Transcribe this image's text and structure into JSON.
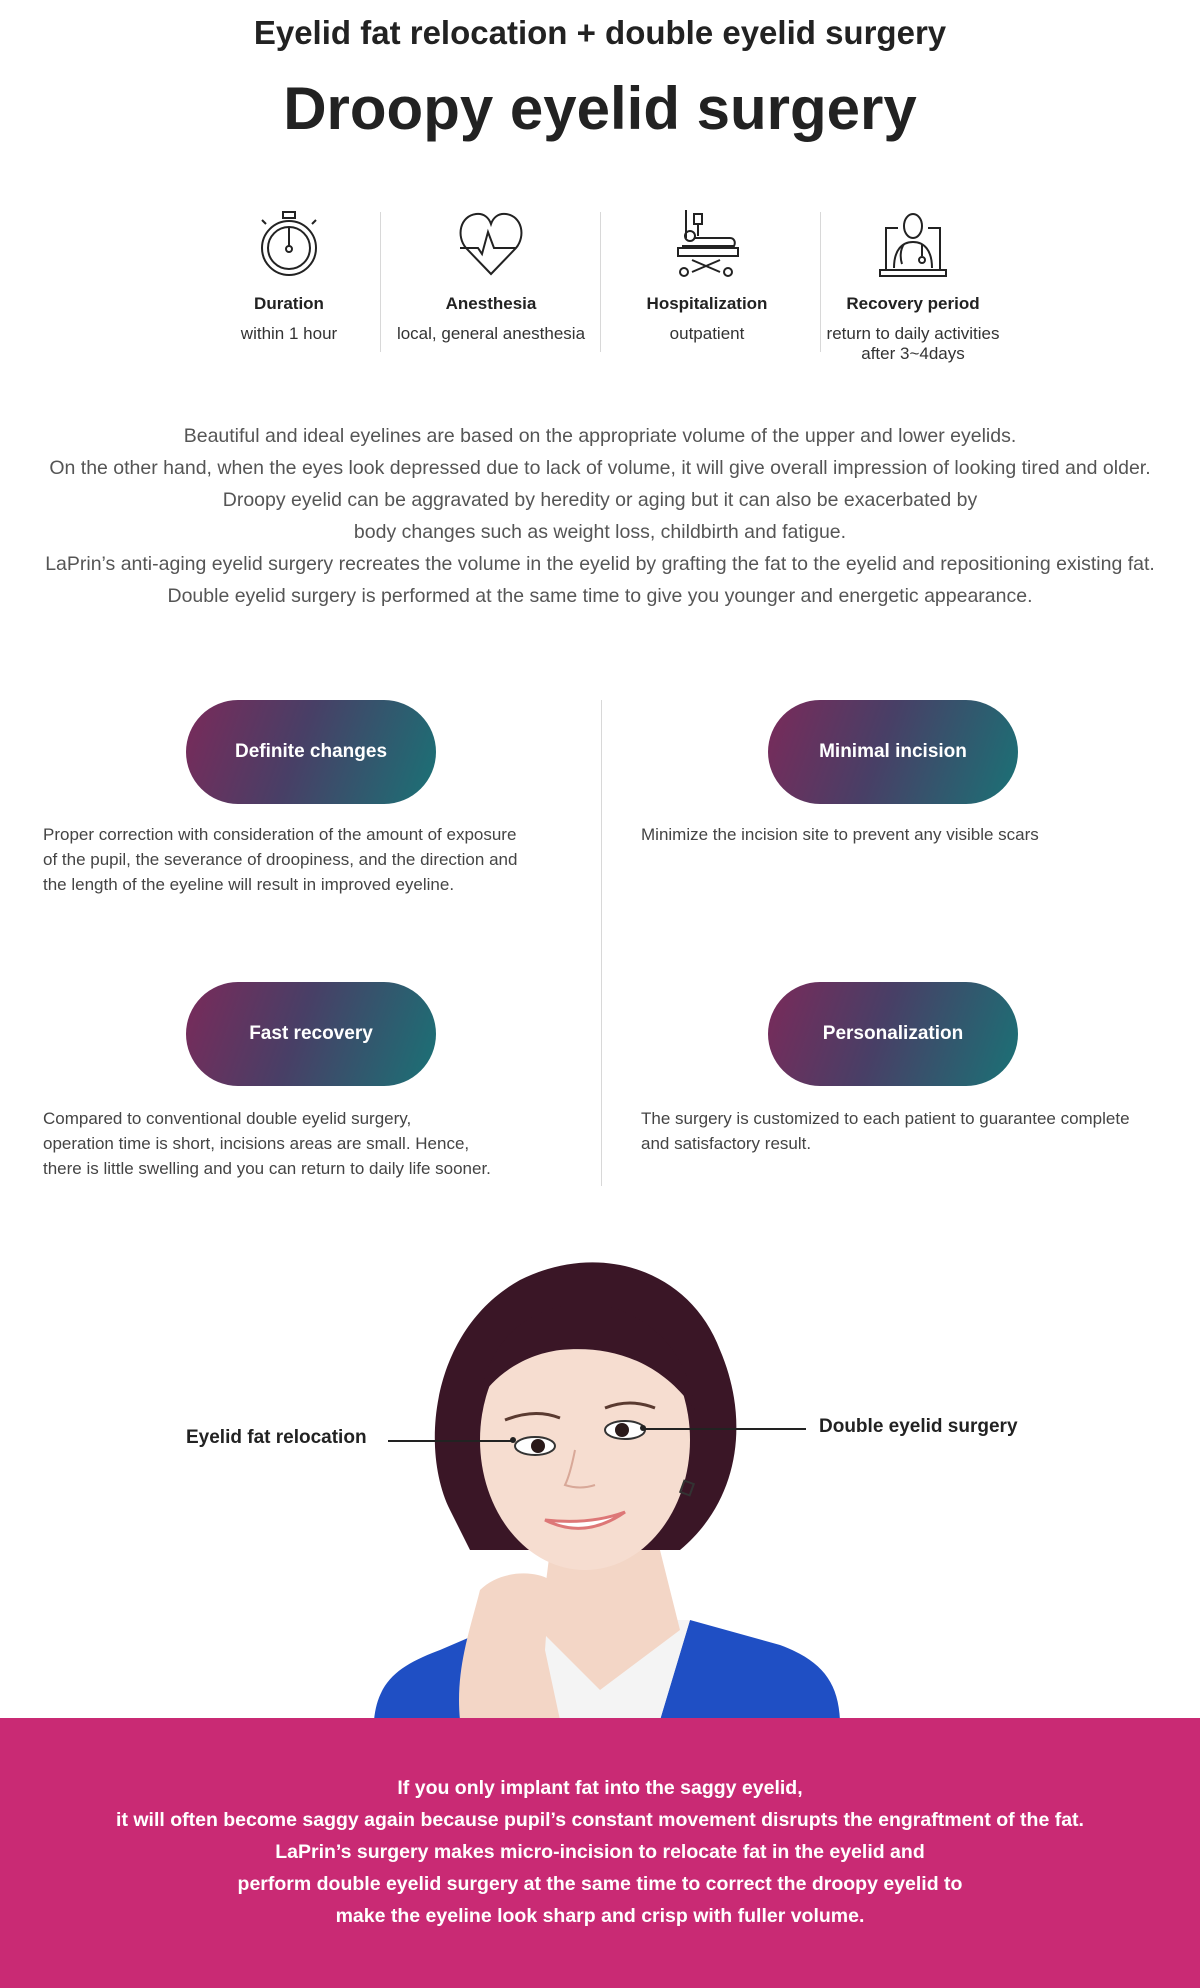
{
  "header": {
    "subtitle": "Eyelid fat relocation + double eyelid surgery",
    "title": "Droopy eyelid surgery"
  },
  "stats": [
    {
      "icon": "stopwatch-icon",
      "label": "Duration",
      "value": "within 1 hour"
    },
    {
      "icon": "heartbeat-icon",
      "label": "Anesthesia",
      "value": "local, general anesthesia"
    },
    {
      "icon": "hospital-bed-icon",
      "label": "Hospitalization",
      "value": "outpatient"
    },
    {
      "icon": "doctor-icon",
      "label": "Recovery period",
      "value": "return to daily activities",
      "value2": "after 3~4days"
    }
  ],
  "intro": [
    "Beautiful and ideal eyelines are based on the appropriate volume of the upper and lower eyelids.",
    "On the other hand, when the eyes look depressed due to lack of volume, it will give overall impression of looking tired and older.",
    "Droopy eyelid can be aggravated by heredity or aging but it can also be exacerbated by",
    "body changes such as weight loss, childbirth and fatigue.",
    "LaPrin’s anti-aging eyelid surgery recreates the volume in the eyelid by grafting the fat to the eyelid and repositioning existing fat.",
    "Double eyelid surgery is performed at the same time to give you younger and energetic appearance."
  ],
  "features": [
    {
      "title": "Definite changes",
      "lines": [
        "Proper correction with consideration of the amount of exposure",
        "of the pupil, the severance of droopiness, and the direction and",
        "the length of the eyeline will result in improved eyeline."
      ]
    },
    {
      "title": "Minimal incision",
      "lines": [
        "Minimize the incision site to prevent any visible scars"
      ]
    },
    {
      "title": "Fast recovery",
      "lines": [
        "Compared to conventional double eyelid surgery,",
        "operation time is short, incisions areas are small. Hence,",
        "there is little swelling and you can return to daily life sooner."
      ]
    },
    {
      "title": "Personalization",
      "lines": [
        "The surgery is customized to each patient to guarantee complete",
        "and satisfactory result."
      ]
    }
  ],
  "callouts": {
    "left": "Eyelid fat relocation",
    "right": "Double eyelid surgery"
  },
  "band": {
    "lines": [
      "If you only implant fat into the saggy eyelid,",
      "it will often become saggy again because pupil’s constant movement disrupts the engraftment of the fat.",
      "LaPrin’s surgery makes micro-incision to relocate fat in the eyelid and",
      "perform double eyelid surgery at the same time to correct the droopy eyelid to",
      "make the eyeline look sharp and crisp with fuller volume."
    ]
  },
  "colors": {
    "band": "#c92a74",
    "pill_start": "#7a2a5a",
    "pill_end": "#1a7276",
    "jacket": "#1f4fc4"
  }
}
